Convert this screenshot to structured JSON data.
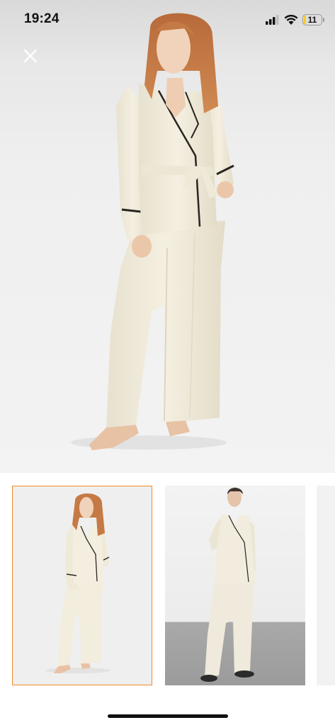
{
  "status_bar": {
    "time": "19:24",
    "battery_level": "11",
    "battery_color": "#f2cc2c",
    "icons": [
      "signal-icon",
      "wifi-icon",
      "battery-icon"
    ]
  },
  "viewer": {
    "close_icon": "close-icon",
    "main_image": "model-in-cream-satin-pajama-set",
    "thumbnails": [
      {
        "image": "thumbnail-model-front",
        "selected": true
      },
      {
        "image": "thumbnail-model-alt",
        "selected": false
      },
      {
        "image": "thumbnail-partial",
        "selected": false
      }
    ],
    "selected_border_color": "#f08a24"
  }
}
